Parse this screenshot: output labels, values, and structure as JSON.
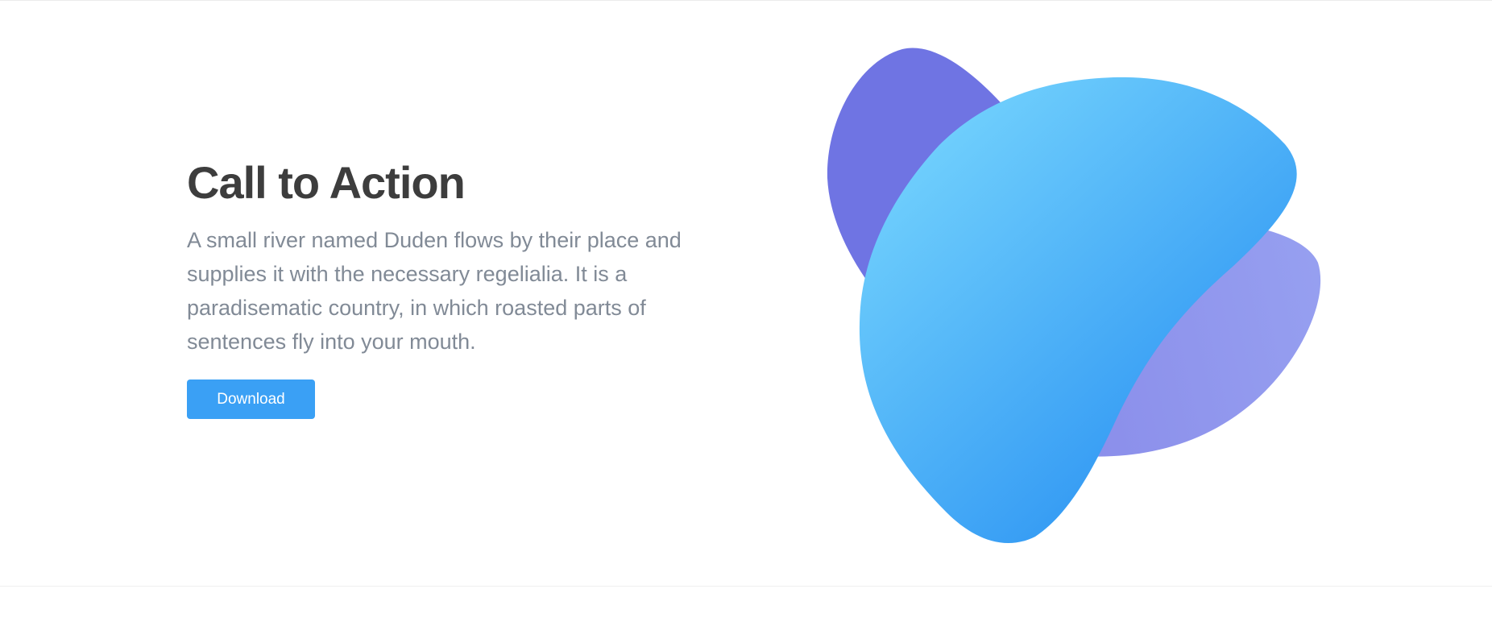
{
  "hero": {
    "title": "Call to Action",
    "description": "A small river named Duden flows by their place and supplies it with the necessary regelialia. It is a paradisematic country, in which roasted parts of sentences fly into your mouth.",
    "button_label": "Download"
  },
  "illustration": {
    "shapes": [
      "blob-back-purple",
      "blob-right-lavender",
      "blob-front-blue"
    ]
  },
  "colors": {
    "title": "#3d3d3d",
    "text": "#818a96",
    "button": "#3aa0f5",
    "blob_purple": "#6f74e3",
    "blob_lavender": "#9198ee",
    "blob_blue_light": "#74d3fd",
    "blob_blue_dark": "#2f96f3"
  }
}
